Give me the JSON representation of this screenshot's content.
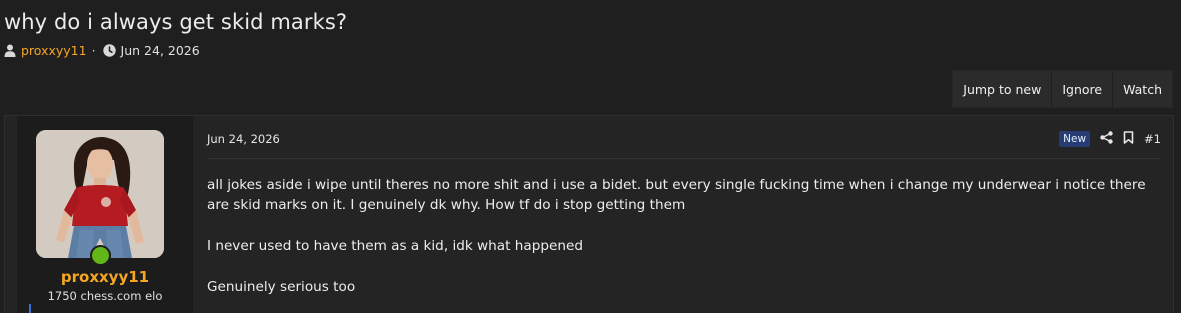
{
  "thread": {
    "title": "why do i always get skid marks?",
    "author": "proxxyy11",
    "separator": "·",
    "date": "Jun 24, 2026"
  },
  "actions": {
    "jump_to_new": "Jump to new",
    "ignore": "Ignore",
    "watch": "Watch"
  },
  "post": {
    "user": {
      "name": "proxxyy11",
      "title": "1750 chess.com elo",
      "online": true
    },
    "date": "Jun 24, 2026",
    "badge": "New",
    "number": "#1",
    "paragraphs": [
      "all jokes aside i wipe until theres no more shit and i use a bidet. but every single fucking time when i change my underwear i notice there are skid marks on it. I genuinely dk why. How tf do i stop getting them",
      "I never used to have them as a kid, idk what happened",
      "Genuinely serious too"
    ]
  },
  "colors": {
    "accent_orange": "#f5a623",
    "online_green": "#63b617",
    "new_badge_bg": "#263c73",
    "background": "#1f1f1f"
  },
  "icons": [
    "user-icon",
    "clock-icon",
    "share-icon",
    "bookmark-icon"
  ]
}
